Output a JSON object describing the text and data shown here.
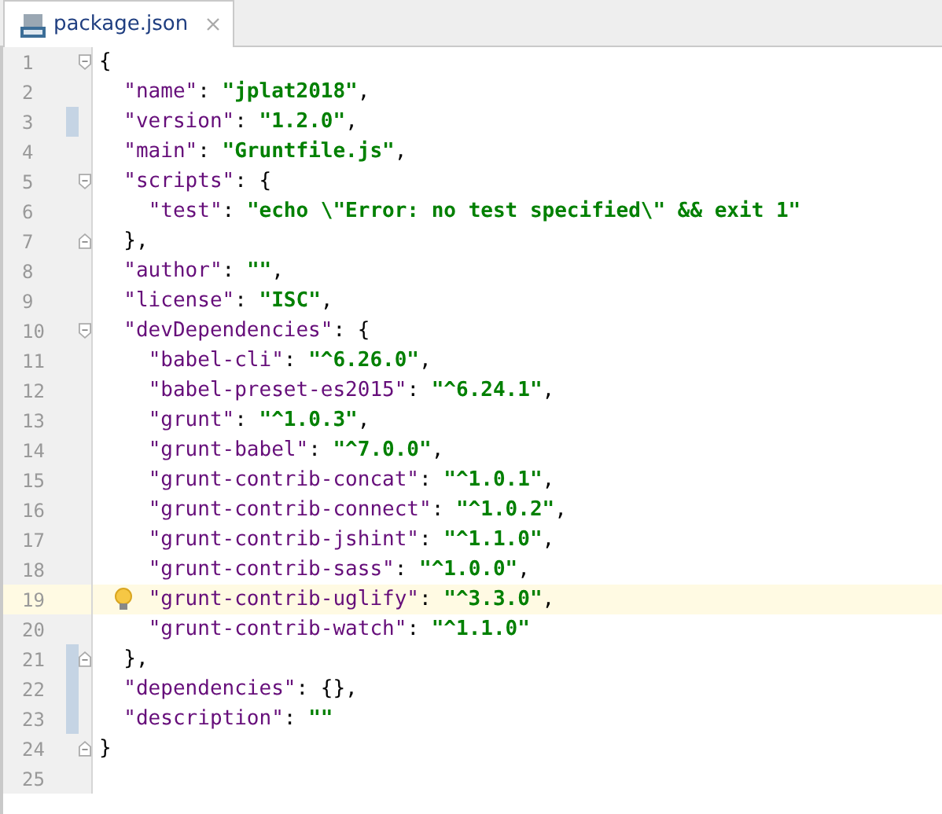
{
  "tab": {
    "label": "package.json",
    "selected": true
  },
  "lines": [
    {
      "number": "1",
      "fold_open": true,
      "fold_close": false,
      "changed": false,
      "current": false,
      "hint": false,
      "tokens": [
        {
          "kind": "punct",
          "text": "{"
        }
      ]
    },
    {
      "number": "2",
      "fold_open": false,
      "fold_close": false,
      "changed": false,
      "current": false,
      "hint": false,
      "tokens": [
        {
          "kind": "key",
          "text": "  \"name\""
        },
        {
          "kind": "punct",
          "text": ": "
        },
        {
          "kind": "string",
          "text": "\"jplat2018\""
        },
        {
          "kind": "punct",
          "text": ","
        }
      ]
    },
    {
      "number": "3",
      "fold_open": false,
      "fold_close": false,
      "changed": true,
      "current": false,
      "hint": false,
      "tokens": [
        {
          "kind": "key",
          "text": "  \"version\""
        },
        {
          "kind": "punct",
          "text": ": "
        },
        {
          "kind": "string",
          "text": "\"1.2.0\""
        },
        {
          "kind": "punct",
          "text": ","
        }
      ]
    },
    {
      "number": "4",
      "fold_open": false,
      "fold_close": false,
      "changed": false,
      "current": false,
      "hint": false,
      "tokens": [
        {
          "kind": "key",
          "text": "  \"main\""
        },
        {
          "kind": "punct",
          "text": ": "
        },
        {
          "kind": "string",
          "text": "\"Gruntfile.js\""
        },
        {
          "kind": "punct",
          "text": ","
        }
      ]
    },
    {
      "number": "5",
      "fold_open": true,
      "fold_close": false,
      "changed": false,
      "current": false,
      "hint": false,
      "tokens": [
        {
          "kind": "key",
          "text": "  \"scripts\""
        },
        {
          "kind": "punct",
          "text": ": {"
        }
      ]
    },
    {
      "number": "6",
      "fold_open": false,
      "fold_close": false,
      "changed": false,
      "current": false,
      "hint": false,
      "tokens": [
        {
          "kind": "key",
          "text": "    \"test\""
        },
        {
          "kind": "punct",
          "text": ": "
        },
        {
          "kind": "string",
          "text": "\"echo \\\"Error: no test specified\\\" && exit 1\""
        }
      ]
    },
    {
      "number": "7",
      "fold_open": false,
      "fold_close": true,
      "changed": false,
      "current": false,
      "hint": false,
      "tokens": [
        {
          "kind": "punct",
          "text": "  },"
        }
      ]
    },
    {
      "number": "8",
      "fold_open": false,
      "fold_close": false,
      "changed": false,
      "current": false,
      "hint": false,
      "tokens": [
        {
          "kind": "key",
          "text": "  \"author\""
        },
        {
          "kind": "punct",
          "text": ": "
        },
        {
          "kind": "string",
          "text": "\"\""
        },
        {
          "kind": "punct",
          "text": ","
        }
      ]
    },
    {
      "number": "9",
      "fold_open": false,
      "fold_close": false,
      "changed": false,
      "current": false,
      "hint": false,
      "tokens": [
        {
          "kind": "key",
          "text": "  \"license\""
        },
        {
          "kind": "punct",
          "text": ": "
        },
        {
          "kind": "string",
          "text": "\"ISC\""
        },
        {
          "kind": "punct",
          "text": ","
        }
      ]
    },
    {
      "number": "10",
      "fold_open": true,
      "fold_close": false,
      "changed": false,
      "current": false,
      "hint": false,
      "tokens": [
        {
          "kind": "key",
          "text": "  \"devDependencies\""
        },
        {
          "kind": "punct",
          "text": ": {"
        }
      ]
    },
    {
      "number": "11",
      "fold_open": false,
      "fold_close": false,
      "changed": false,
      "current": false,
      "hint": false,
      "tokens": [
        {
          "kind": "key",
          "text": "    \"babel-cli\""
        },
        {
          "kind": "punct",
          "text": ": "
        },
        {
          "kind": "string",
          "text": "\"^6.26.0\""
        },
        {
          "kind": "punct",
          "text": ","
        }
      ]
    },
    {
      "number": "12",
      "fold_open": false,
      "fold_close": false,
      "changed": false,
      "current": false,
      "hint": false,
      "tokens": [
        {
          "kind": "key",
          "text": "    \"babel-preset-es2015\""
        },
        {
          "kind": "punct",
          "text": ": "
        },
        {
          "kind": "string",
          "text": "\"^6.24.1\""
        },
        {
          "kind": "punct",
          "text": ","
        }
      ]
    },
    {
      "number": "13",
      "fold_open": false,
      "fold_close": false,
      "changed": false,
      "current": false,
      "hint": false,
      "tokens": [
        {
          "kind": "key",
          "text": "    \"grunt\""
        },
        {
          "kind": "punct",
          "text": ": "
        },
        {
          "kind": "string",
          "text": "\"^1.0.3\""
        },
        {
          "kind": "punct",
          "text": ","
        }
      ]
    },
    {
      "number": "14",
      "fold_open": false,
      "fold_close": false,
      "changed": false,
      "current": false,
      "hint": false,
      "tokens": [
        {
          "kind": "key",
          "text": "    \"grunt-babel\""
        },
        {
          "kind": "punct",
          "text": ": "
        },
        {
          "kind": "string",
          "text": "\"^7.0.0\""
        },
        {
          "kind": "punct",
          "text": ","
        }
      ]
    },
    {
      "number": "15",
      "fold_open": false,
      "fold_close": false,
      "changed": false,
      "current": false,
      "hint": false,
      "tokens": [
        {
          "kind": "key",
          "text": "    \"grunt-contrib-concat\""
        },
        {
          "kind": "punct",
          "text": ": "
        },
        {
          "kind": "string",
          "text": "\"^1.0.1\""
        },
        {
          "kind": "punct",
          "text": ","
        }
      ]
    },
    {
      "number": "16",
      "fold_open": false,
      "fold_close": false,
      "changed": false,
      "current": false,
      "hint": false,
      "tokens": [
        {
          "kind": "key",
          "text": "    \"grunt-contrib-connect\""
        },
        {
          "kind": "punct",
          "text": ": "
        },
        {
          "kind": "string",
          "text": "\"^1.0.2\""
        },
        {
          "kind": "punct",
          "text": ","
        }
      ]
    },
    {
      "number": "17",
      "fold_open": false,
      "fold_close": false,
      "changed": false,
      "current": false,
      "hint": false,
      "tokens": [
        {
          "kind": "key",
          "text": "    \"grunt-contrib-jshint\""
        },
        {
          "kind": "punct",
          "text": ": "
        },
        {
          "kind": "string",
          "text": "\"^1.1.0\""
        },
        {
          "kind": "punct",
          "text": ","
        }
      ]
    },
    {
      "number": "18",
      "fold_open": false,
      "fold_close": false,
      "changed": false,
      "current": false,
      "hint": false,
      "tokens": [
        {
          "kind": "key",
          "text": "    \"grunt-contrib-sass\""
        },
        {
          "kind": "punct",
          "text": ": "
        },
        {
          "kind": "string",
          "text": "\"^1.0.0\""
        },
        {
          "kind": "punct",
          "text": ","
        }
      ]
    },
    {
      "number": "19",
      "fold_open": false,
      "fold_close": false,
      "changed": false,
      "current": true,
      "hint": true,
      "tokens": [
        {
          "kind": "key",
          "text": "    \"grunt-contrib-uglify\""
        },
        {
          "kind": "punct",
          "text": ": "
        },
        {
          "kind": "string",
          "text": "\"^3.3.0\""
        },
        {
          "kind": "punct",
          "text": ","
        }
      ]
    },
    {
      "number": "20",
      "fold_open": false,
      "fold_close": false,
      "changed": false,
      "current": false,
      "hint": false,
      "tokens": [
        {
          "kind": "key",
          "text": "    \"grunt-contrib-watch\""
        },
        {
          "kind": "punct",
          "text": ": "
        },
        {
          "kind": "string",
          "text": "\"^1.1.0\""
        }
      ]
    },
    {
      "number": "21",
      "fold_open": false,
      "fold_close": true,
      "changed": true,
      "current": false,
      "hint": false,
      "tokens": [
        {
          "kind": "punct",
          "text": "  },"
        }
      ]
    },
    {
      "number": "22",
      "fold_open": false,
      "fold_close": false,
      "changed": true,
      "current": false,
      "hint": false,
      "tokens": [
        {
          "kind": "key",
          "text": "  \"dependencies\""
        },
        {
          "kind": "punct",
          "text": ": {},"
        }
      ]
    },
    {
      "number": "23",
      "fold_open": false,
      "fold_close": false,
      "changed": true,
      "current": false,
      "hint": false,
      "tokens": [
        {
          "kind": "key",
          "text": "  \"description\""
        },
        {
          "kind": "punct",
          "text": ": "
        },
        {
          "kind": "string",
          "text": "\"\""
        }
      ]
    },
    {
      "number": "24",
      "fold_open": false,
      "fold_close": true,
      "changed": false,
      "current": false,
      "hint": false,
      "tokens": [
        {
          "kind": "punct",
          "text": "}"
        }
      ]
    },
    {
      "number": "25",
      "fold_open": false,
      "fold_close": false,
      "changed": false,
      "current": false,
      "hint": false
    }
  ]
}
